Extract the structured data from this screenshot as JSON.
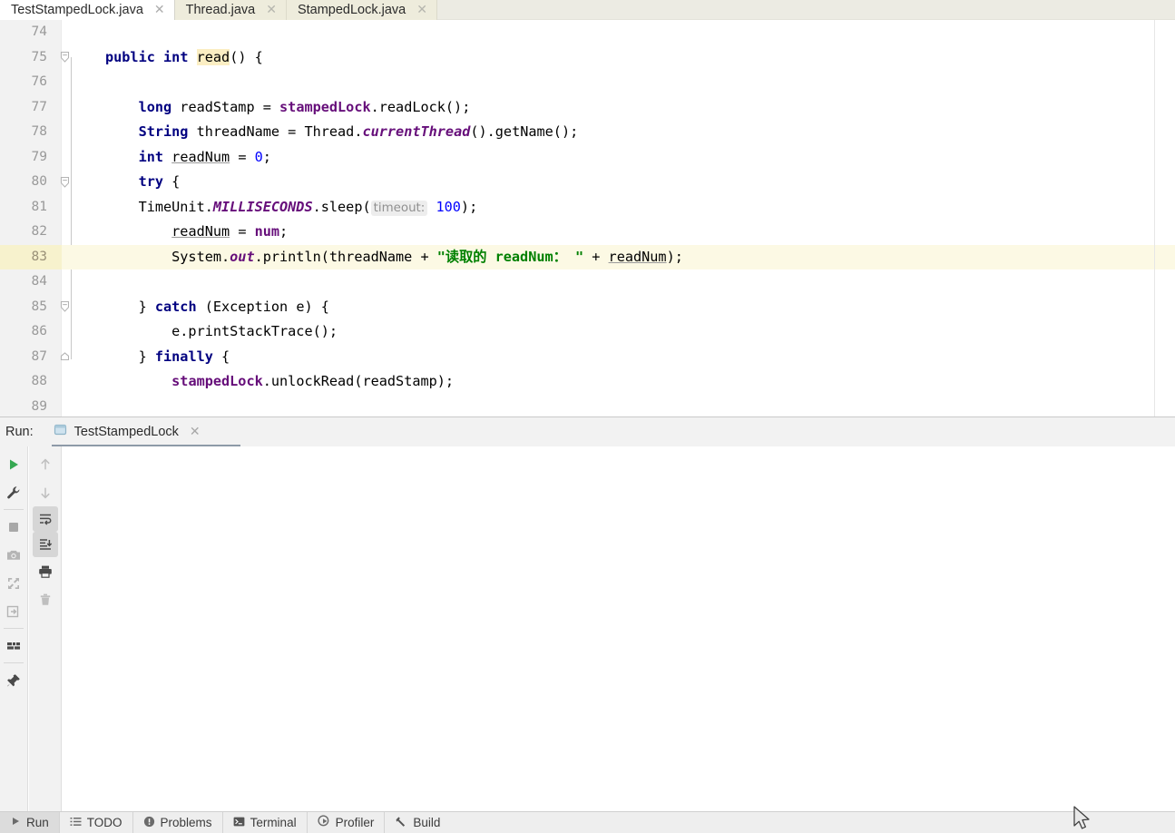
{
  "editor_tabs": [
    {
      "label": "TestStampedLock.java",
      "active": true,
      "close": "✕"
    },
    {
      "label": "Thread.java",
      "active": false,
      "close": "✕"
    },
    {
      "label": "StampedLock.java",
      "active": false,
      "close": "✕"
    }
  ],
  "code": {
    "first_line": 74,
    "highlighted_line": 83,
    "lines": [
      {
        "n": 74,
        "fold": "",
        "text": ""
      },
      {
        "n": 75,
        "fold": "down",
        "text": "public int read() {"
      },
      {
        "n": 76,
        "fold": "",
        "text": ""
      },
      {
        "n": 77,
        "fold": "",
        "text": "    long readStamp = stampedLock.readLock();"
      },
      {
        "n": 78,
        "fold": "",
        "text": "    String threadName = Thread.currentThread().getName();"
      },
      {
        "n": 79,
        "fold": "",
        "text": "    int readNum = 0;"
      },
      {
        "n": 80,
        "fold": "down",
        "text": "    try {"
      },
      {
        "n": 81,
        "fold": "",
        "text": "        TimeUnit.MILLISECONDS.sleep( timeout: 100);"
      },
      {
        "n": 82,
        "fold": "",
        "text": "        readNum = num;"
      },
      {
        "n": 83,
        "fold": "",
        "text": "        System.out.println(threadName + \"读取的 readNum： \" + readNum);"
      },
      {
        "n": 84,
        "fold": "",
        "text": ""
      },
      {
        "n": 85,
        "fold": "down",
        "text": "    } catch (Exception e) {"
      },
      {
        "n": 86,
        "fold": "",
        "text": "        e.printStackTrace();"
      },
      {
        "n": 87,
        "fold": "up",
        "text": "    } finally {"
      },
      {
        "n": 88,
        "fold": "",
        "text": "        stampedLock.unlockRead(readStamp);"
      },
      {
        "n": 89,
        "fold": "",
        "text": ""
      }
    ],
    "inlay_hint": "timeout:",
    "highlighted_word": "read",
    "string_literal": "\"读取的 readNum： \"",
    "colors": {
      "keyword": "#000080",
      "field": "#660e7a",
      "string": "#008000",
      "number": "#0000ff",
      "static_italic": "#660e7a",
      "highlight_row": "#fcf9e4",
      "identifier_highlight": "#fbeec3"
    }
  },
  "run_panel": {
    "label": "Run:",
    "tab": {
      "label": "TestStampedLock",
      "close": "✕",
      "icon": "run-config-icon"
    },
    "toolbar_left": [
      {
        "name": "rerun-icon",
        "title": "Rerun"
      },
      {
        "name": "edit-configuration-icon",
        "title": "Edit Configuration"
      },
      {
        "name": "stop-icon",
        "title": "Stop"
      },
      {
        "name": "camera-icon",
        "title": "Capture Memory Snapshot"
      },
      {
        "name": "thread-dump-icon",
        "title": "Thread Dump"
      },
      {
        "name": "export-icon",
        "title": "Export"
      },
      {
        "name": "console-icon",
        "title": "Console"
      },
      {
        "name": "pin-icon",
        "title": "Pin Tab"
      }
    ],
    "toolbar_right": [
      {
        "name": "up-arrow-icon",
        "title": "Up the Stack Trace",
        "selected": false
      },
      {
        "name": "down-arrow-icon",
        "title": "Down the Stack Trace",
        "selected": false
      },
      {
        "name": "soft-wrap-icon",
        "title": "Use Soft Wraps",
        "selected": true
      },
      {
        "name": "scroll-to-end-icon",
        "title": "Scroll to the End",
        "selected": true
      },
      {
        "name": "print-icon",
        "title": "Print",
        "selected": false
      },
      {
        "name": "trash-icon",
        "title": "Clear All",
        "selected": false
      }
    ],
    "console_output": ""
  },
  "status_bar": {
    "items": [
      {
        "label": "Run",
        "icon": "play-icon",
        "active": true
      },
      {
        "label": "TODO",
        "icon": "list-icon",
        "active": false
      },
      {
        "label": "Problems",
        "icon": "warning-icon",
        "active": false
      },
      {
        "label": "Terminal",
        "icon": "terminal-icon",
        "active": false
      },
      {
        "label": "Profiler",
        "icon": "profiler-icon",
        "active": false
      },
      {
        "label": "Build",
        "icon": "hammer-icon",
        "active": false
      }
    ]
  }
}
